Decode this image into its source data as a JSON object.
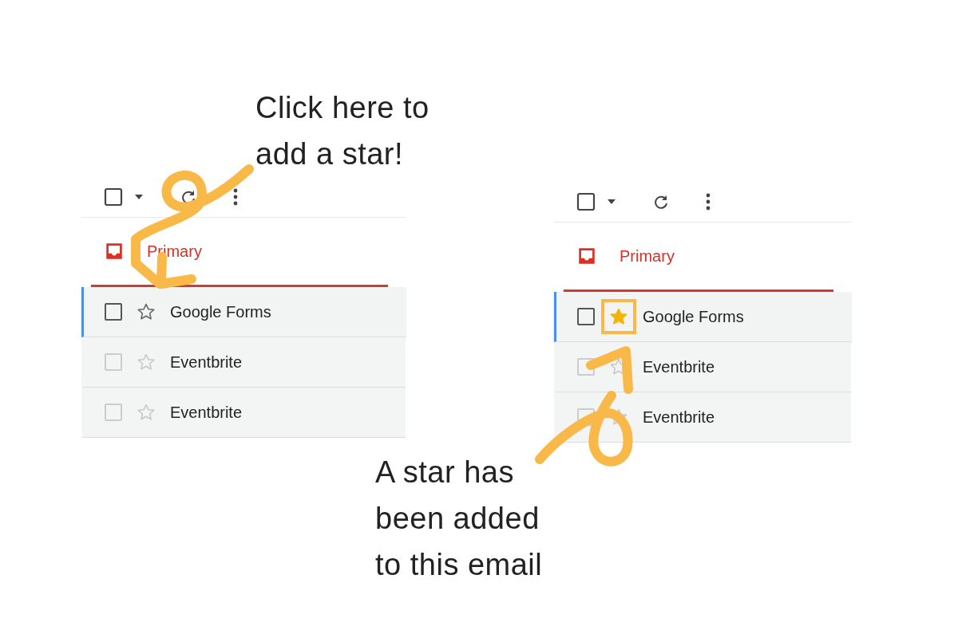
{
  "captions": [
    {
      "lines": [
        "Click here to",
        "add a star!"
      ]
    },
    {
      "lines": [
        "A star has",
        "been added",
        "to this email"
      ]
    }
  ],
  "panels": [
    {
      "tab": {
        "label": "Primary"
      },
      "rows": [
        {
          "sender": "Google Forms",
          "selected": true,
          "starred": false,
          "highlighted": false
        },
        {
          "sender": "Eventbrite",
          "selected": false,
          "starred": false,
          "highlighted": false
        },
        {
          "sender": "Eventbrite",
          "selected": false,
          "starred": false,
          "highlighted": false
        }
      ]
    },
    {
      "tab": {
        "label": "Primary"
      },
      "rows": [
        {
          "sender": "Google Forms",
          "selected": true,
          "starred": true,
          "highlighted": true
        },
        {
          "sender": "Eventbrite",
          "selected": false,
          "starred": false,
          "highlighted": false
        },
        {
          "sender": "Eventbrite",
          "selected": false,
          "starred": false,
          "highlighted": false
        }
      ]
    }
  ]
}
